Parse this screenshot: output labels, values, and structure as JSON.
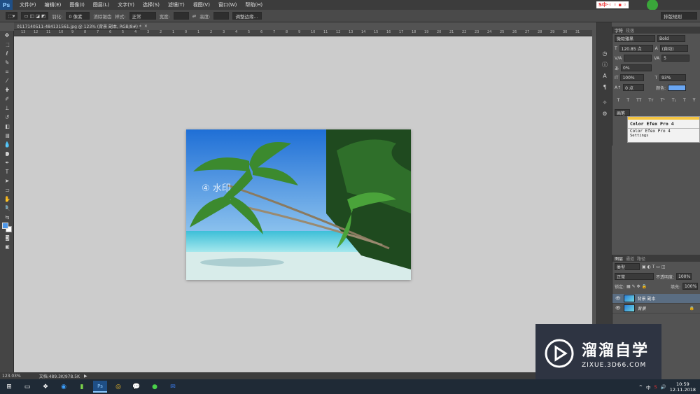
{
  "menu": {
    "logo": "Ps",
    "items": [
      "文件(F)",
      "编辑(E)",
      "图像(I)",
      "图层(L)",
      "文字(Y)",
      "选择(S)",
      "滤镜(T)",
      "视图(V)",
      "窗口(W)",
      "帮助(H)"
    ]
  },
  "options": {
    "feather_label": "羽化:",
    "feather_value": "0 像素",
    "antialias_label": "消除锯齿",
    "style_label": "样式:",
    "style_value": "正常",
    "width_label": "宽度:",
    "height_label": "高度:",
    "refine_button": "调整边缘...",
    "workspace_value": "排版规则"
  },
  "document": {
    "tab_title": "0117140511-484131561.jpg @ 123% (背景 副本, RGB/8#) *",
    "zoom": "123.03%",
    "doc_info": "文档:489.3K/978.5K",
    "watermark_text": "④ 水印"
  },
  "ruler_ticks": [
    "13",
    "12",
    "11",
    "10",
    "9",
    "8",
    "7",
    "6",
    "5",
    "4",
    "3",
    "2",
    "1",
    "0",
    "1",
    "2",
    "3",
    "4",
    "5",
    "6",
    "7",
    "8",
    "9",
    "10",
    "11",
    "12",
    "13",
    "14",
    "15",
    "16",
    "17",
    "18",
    "19",
    "20",
    "21",
    "22",
    "23",
    "24",
    "25",
    "26",
    "27",
    "28",
    "29",
    "30",
    "31"
  ],
  "char_panel": {
    "tab_active": "字符",
    "tab_inactive": "段落",
    "font_family": "微软雅黑",
    "font_style": "Bold",
    "font_size": "120.85 点",
    "leading": "(自动)",
    "kerning": "",
    "tracking": "5",
    "scale_pct": "0%",
    "vscale": "100%",
    "hscale": "93%",
    "baseline": "0 点",
    "color_label": "颜色:",
    "color_value": "#6aa6f2",
    "type_buttons": [
      "T",
      "T",
      "TT",
      "Tт",
      "T¹",
      "T₁",
      "T",
      "Ŧ"
    ],
    "panel_label": "画笔"
  },
  "color_efex": {
    "title": "Color Efex Pro 4",
    "subtitle": "Color Efex Pro 4",
    "settings": "Settings"
  },
  "layers_panel": {
    "tabs": [
      "图层",
      "通道",
      "路径"
    ],
    "filter_label": "类型",
    "blend_mode": "正常",
    "opacity_label": "不透明度:",
    "opacity_value": "100%",
    "lock_label": "锁定:",
    "fill_label": "填充:",
    "fill_value": "100%",
    "layers": [
      {
        "name": "背景 副本",
        "selected": true
      },
      {
        "name": "背景",
        "selected": false
      }
    ]
  },
  "watermark_logo": {
    "title": "溜溜自学",
    "url": "ZIXUE.3D66.COM"
  },
  "taskbar": {
    "tray_lang": "中",
    "time": "10:59",
    "date": "12.11.2018"
  },
  "colors": {
    "canvas_bg": "#cccccc",
    "app_bg": "#535353",
    "accent_blue": "#6aa6f2"
  }
}
